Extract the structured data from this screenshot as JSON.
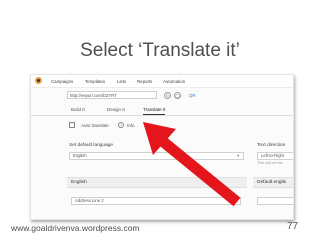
{
  "slide": {
    "title": "Select ‘Translate it’",
    "footer_url": "www.goaldrivenva.wordpress.com",
    "page_number": "77"
  },
  "app": {
    "nav": [
      "Campaigns",
      "Templates",
      "Lists",
      "Reports",
      "Automation"
    ],
    "url_value": "http://eepurl.com/bZYRT",
    "qr_label": "QR",
    "tabs": [
      "Build It",
      "Design It",
      "Translate It"
    ],
    "active_tab": "Translate It",
    "auto_translate_label": "Auto translate",
    "info_label": "Info",
    "default_language_label": "Set default language",
    "default_language_value": "English",
    "text_direction_label": "Text direction",
    "text_direction_value": "Left-to-Right",
    "text_direction_hint": "This will set the",
    "section_language": "English",
    "section_default": "Default englis",
    "address_value": "Address Line 2"
  },
  "colors": {
    "arrow": "#e4161c",
    "link": "#3d7bd4",
    "title_text": "#4f4f4f"
  }
}
